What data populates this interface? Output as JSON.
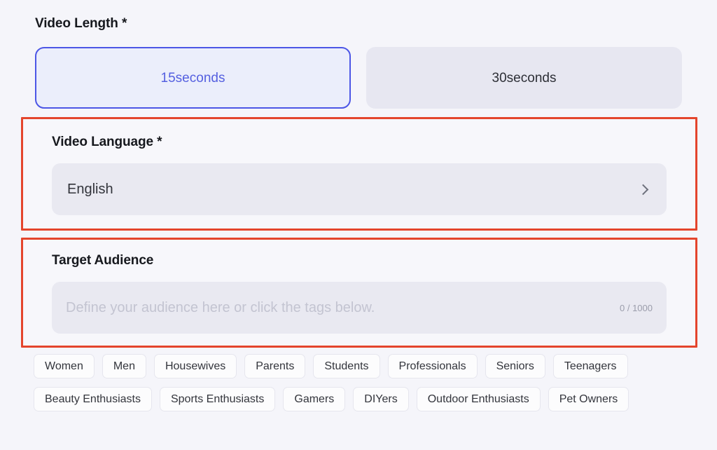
{
  "video_length": {
    "label": "Video Length *",
    "options": [
      {
        "label": "15seconds",
        "selected": true
      },
      {
        "label": "30seconds",
        "selected": false
      }
    ],
    "selected_color": "#5560e0",
    "selected_border": "#4c56e6",
    "selected_bg": "#ebeefb"
  },
  "video_language": {
    "label": "Video Language *",
    "selected_value": "English",
    "chevron_icon": "chevron-right-icon",
    "highlight_color": "#e4452c"
  },
  "target_audience": {
    "label": "Target Audience",
    "input_value": "",
    "placeholder": "Define your audience here or click the tags below.",
    "char_counter": "0 / 1000",
    "highlight_color": "#e4452c"
  },
  "audience_tags": {
    "row1": [
      "Women",
      "Men",
      "Housewives",
      "Parents",
      "Students",
      "Professionals",
      "Seniors",
      "Teenagers"
    ],
    "row2": [
      "Beauty Enthusiasts",
      "Sports Enthusiasts",
      "Gamers",
      "DIYers",
      "Outdoor Enthusiasts",
      "Pet Owners"
    ]
  },
  "theme": {
    "page_bg": "#f5f5fa",
    "field_bg": "#e9e9f1",
    "tag_bg": "#fcfcfd",
    "text_primary": "#16181d"
  }
}
